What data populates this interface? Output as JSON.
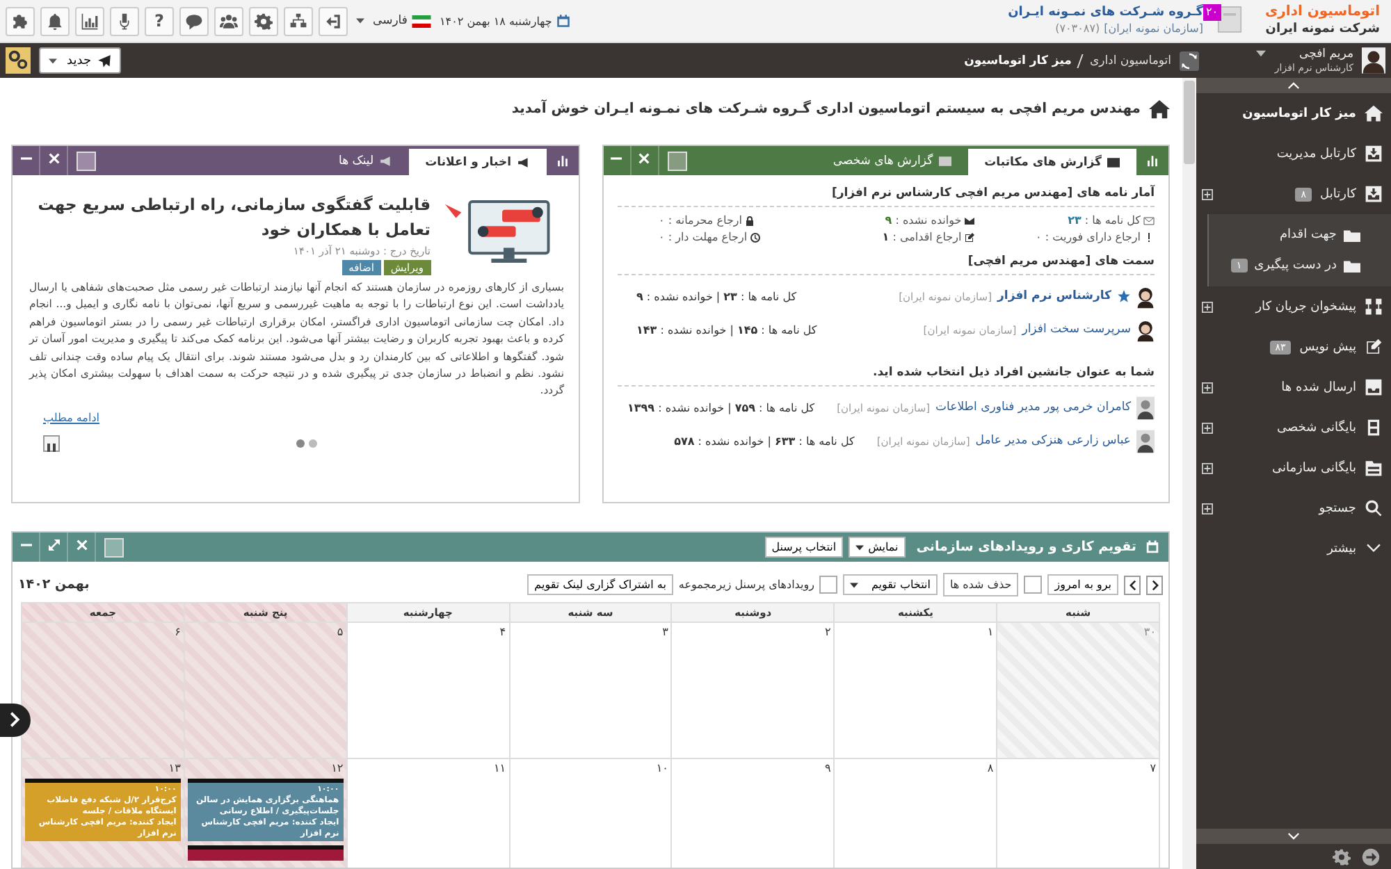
{
  "header": {
    "logo_title": "اتوماسیون اداری",
    "logo_subtitle": "شرکت نمونه ایران",
    "org_badge": "۲۰",
    "org_name": "گـروه شـرکت های نمـونه ایـران",
    "org_code": "(۷۰۳۰۸۷)",
    "org_sub": "[سازمان نمونه ایران]",
    "date": "چهارشنبه ۱۸ بهمن ۱۴۰۲",
    "language": "فارسی",
    "help_label": "?"
  },
  "user_bar": {
    "name": "مریم افچی",
    "role": "کارشناس نرم افزار",
    "breadcrumb": [
      "اتوماسیون اداری",
      "میز کار اتوماسیون"
    ],
    "new_button": "جدید"
  },
  "sidebar": {
    "items": [
      {
        "label": "میز کار اتوماسیون",
        "selected": true,
        "expandable": false
      },
      {
        "label": "کارتابل مدیریت",
        "selected": false,
        "expandable": false
      },
      {
        "label": "کارتابل",
        "badge": "۸",
        "selected": false,
        "expandable": true,
        "children": [
          {
            "label": "جهت اقدام"
          },
          {
            "label": "در دست پیگیری",
            "badge": "۱"
          }
        ]
      },
      {
        "label": "پیشخوان جریان کار",
        "selected": false,
        "expandable": true
      },
      {
        "label": "پیش نویس",
        "badge": "۸۳",
        "selected": false,
        "expandable": false
      },
      {
        "label": "ارسال شده ها",
        "selected": false,
        "expandable": true
      },
      {
        "label": "بایگانی شخصی",
        "selected": false,
        "expandable": true
      },
      {
        "label": "بایگانی سازمانی",
        "selected": false,
        "expandable": true
      },
      {
        "label": "جستجو",
        "selected": false,
        "expandable": true
      },
      {
        "label": "بیشتر",
        "selected": false,
        "expandable": false
      }
    ]
  },
  "welcome": "مهندس مریم افچی به سیستم اتوماسیون اداری گـروه شـرکت های نمـونه ایـران خوش آمدید",
  "reports": {
    "tabs": [
      {
        "label": "گزارش های مکاتبات",
        "selected": true
      },
      {
        "label": "گزارش های شخصی",
        "selected": false
      }
    ],
    "stats_title": "آمار نامه های [مهندس مریم افچی کارشناس نرم افزار]",
    "stats": [
      "کل نامه ها : **۲۳**",
      "خوانده نشده : **۹**",
      "ارجاع محرمانه : ۰",
      "ارجاع دارای فوریت : ۰",
      "ارجاع اقدامی : **۱**",
      "ارجاع مهلت دار : ۰"
    ],
    "positions_title": "سمت های [مهندس مریم افچی]",
    "positions": [
      {
        "name": "کارشناس نرم افزار",
        "primary": true,
        "org": "[سازمان نمونه ایران]",
        "counts": "کل نامه ها : **۲۳** | خوانده نشده : **۹**"
      },
      {
        "name": "سرپرست سخت افزار",
        "primary": false,
        "org": "[سازمان نمونه ایران]",
        "counts": "کل نامه ها : **۱۴۵** | خوانده نشده : **۱۴۳**"
      }
    ],
    "deputy_title": "شما به عنوان جانشین افراد ذیل انتخاب شده اید.",
    "deputies": [
      {
        "name": "کامران خرمی پور مدیر فناوری اطلاعات",
        "org": "[سازمان نمونه ایران]",
        "counts": "کل نامه ها : **۷۵۹** | خوانده نشده : **۱۳۹۹**"
      },
      {
        "name": "عباس زارعی هنزکی مدیر عامل",
        "org": "[سازمان نمونه ایران]",
        "counts": "کل نامه ها : **۶۳۳** | خوانده نشده : **۵۷۸**"
      }
    ]
  },
  "news": {
    "tabs": [
      {
        "label": "اخبار و اعلانات",
        "selected": true
      },
      {
        "label": "لینک ها",
        "selected": false
      }
    ],
    "title": "قابلیت گفتگوی سازمانی، راه ارتباطی سریع جهت تعامل با همکاران خود",
    "date": "تاریخ درج : دوشنبه ۲۱ آذر ۱۴۰۱",
    "edit_button": "ویرایش",
    "add_button": "اضافه",
    "body": "بسیاری از کارهای روزمره در سازمان هستند که انجام آنها نیازمند ارتباطات غیر رسمی مثل صحبت‌های شفاهی یا ارسال یادداشت است. این نوع ارتباطات را با توجه به ماهیت غیررسمی و سریع آنها، نمی‌توان با نامه نگاری و ایمیل و... انجام داد. امکان چت سازمانی اتوماسیون اداری فراگستر، امکان برقراری ارتباطات غیر رسمی را در بستر اتوماسیون فراهم کرده و باعث بهبود تجربه کاربران و رضایت بیشتر آنها می‌شود. این برنامه کمک می‌کند تا پیگیری و مدیریت امور آسان تر شود. گفتگوها و اطلاعاتی که بین کارمندان رد و بدل می‌شود مستند شوند. برای انتقال یک پیام ساده وقت چندانی تلف نشود. نظم و انضباط در سازمان جدی تر پیگیری شده و در نتیجه حرکت به سمت اهداف با سهولت بیشتری امکان پذیر گردد.",
    "more_link": "ادامه مطلب",
    "dots": [
      {
        "selected": true
      },
      {
        "selected": false
      }
    ]
  },
  "calendar": {
    "title": "تقویم کاری و رویدادهای سازمانی",
    "view_button": "نمایش",
    "staff_button": "انتخاب پرسنل",
    "today_button": "برو به امروز",
    "deleted_label": "حذف شده ها",
    "deleted_checked": false,
    "calendar_select": "انتخاب تقویم",
    "sub_label": "رویدادهای پرسنل زیرمجموعه",
    "sub_checked": false,
    "share_button": "به اشتراک گزاری لینک تقویم",
    "month": "بهمن ۱۴۰۲",
    "weekdays": [
      {
        "label": "شنبه",
        "holiday": false
      },
      {
        "label": "یکشنبه",
        "holiday": false
      },
      {
        "label": "دوشنبه",
        "holiday": false
      },
      {
        "label": "سه شنبه",
        "holiday": false
      },
      {
        "label": "چهارشنبه",
        "holiday": false
      },
      {
        "label": "پنج شنبه",
        "holiday": true
      },
      {
        "label": "جمعه",
        "holiday": true
      }
    ],
    "weeks": [
      [
        {
          "day": "۳۰",
          "kind": "other"
        },
        {
          "day": "۱",
          "kind": "normal"
        },
        {
          "day": "۲",
          "kind": "normal"
        },
        {
          "day": "۳",
          "kind": "normal"
        },
        {
          "day": "۴",
          "kind": "normal"
        },
        {
          "day": "۵",
          "kind": "holiday"
        },
        {
          "day": "۶",
          "kind": "holiday"
        }
      ],
      [
        {
          "day": "۷",
          "kind": "normal"
        },
        {
          "day": "۸",
          "kind": "normal"
        },
        {
          "day": "۹",
          "kind": "normal"
        },
        {
          "day": "۱۰",
          "kind": "normal"
        },
        {
          "day": "۱۱",
          "kind": "normal"
        },
        {
          "day": "۱۲",
          "kind": "holiday",
          "events": [
            {
              "time": "۱۰:۰۰",
              "title": "هماهنگی برگزاری همایش در سالن جلسات‌پیگیری / اطلاع رسانی",
              "creator": "ایجاد کننده: مریم افچی کارشناس نرم افزار",
              "color": "#5b8a9e"
            },
            {
              "color": "#a0183a"
            }
          ]
        },
        {
          "day": "۱۳",
          "kind": "holiday",
          "events": [
            {
              "time": "۱۰:۰۰",
              "title": "کرج‌قرار ۲/ل شبکه دفع فاضلاب ایستگاه ملاقات / جلسه",
              "creator": "ایجاد کننده: مریم افچی کارشناس نرم افزار",
              "color": "#d4a02a"
            }
          ]
        }
      ]
    ]
  }
}
